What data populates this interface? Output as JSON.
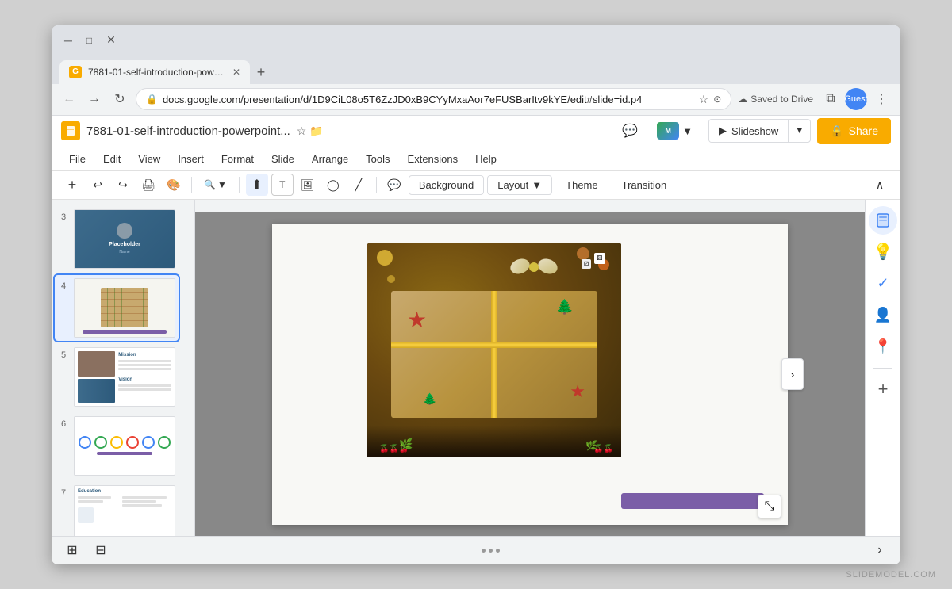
{
  "browser": {
    "url": "docs.google.com/presentation/d/1D9CiL08o5T6ZzJD0xB9CYyMxaAor7eFUSBarItv9kYE/edit#slide=id.p4",
    "tab_title": "7881-01-self-introduction-powe...",
    "saved_to_drive": "Saved to Drive",
    "profile_label": "Guest"
  },
  "document": {
    "title": "7881-01-self-introduction-powerpoint...",
    "menu": {
      "file": "File",
      "edit": "Edit",
      "view": "View",
      "insert": "Insert",
      "format": "Format",
      "slide": "Slide",
      "arrange": "Arrange",
      "tools": "Tools",
      "extensions": "Extensions",
      "help": "Help"
    },
    "toolbar": {
      "background_label": "Background",
      "layout_label": "Layout",
      "theme_label": "Theme",
      "transition_label": "Transition",
      "slideshow_label": "Slideshow",
      "share_label": "Share",
      "format_label": "Format"
    }
  },
  "slides": [
    {
      "number": "3",
      "type": "person"
    },
    {
      "number": "4",
      "type": "gift",
      "active": true
    },
    {
      "number": "5",
      "type": "mission"
    },
    {
      "number": "6",
      "type": "circles"
    },
    {
      "number": "7",
      "type": "education"
    }
  ],
  "right_panel": {
    "icons": [
      "chat",
      "meet",
      "tasks",
      "contacts",
      "maps"
    ]
  },
  "watermark": "SLIDEMODEL.COM"
}
